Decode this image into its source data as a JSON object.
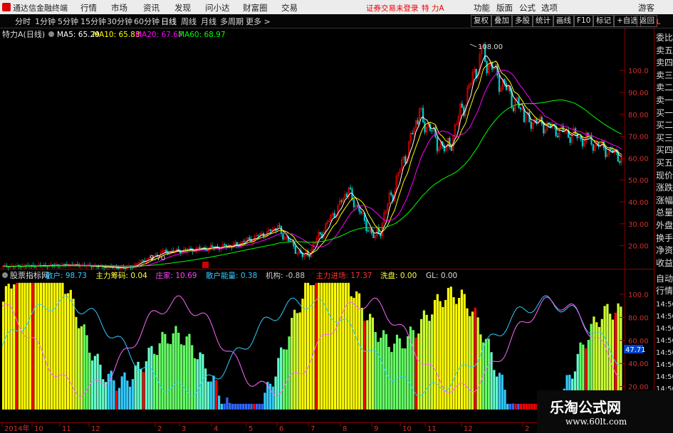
{
  "titlebar": {
    "app_name": "通达信金融终端",
    "menu": [
      "行情",
      "市场",
      "资讯",
      "发现",
      "问小达",
      "财富圈",
      "交易"
    ],
    "login_warning": "证券交易未登录",
    "stock": "特 力A",
    "right_menu": [
      "功能",
      "版面",
      "公式",
      "选项"
    ],
    "guest": "游客"
  },
  "toolbar": {
    "periods": [
      "分时",
      "1分钟",
      "5分钟",
      "15分钟",
      "30分钟",
      "60分钟",
      "日线",
      "周线",
      "月线",
      "多周期",
      "更多 >"
    ],
    "selected": "日线",
    "buttons": [
      "复权",
      "叠加",
      "多股",
      "统计",
      "画线",
      "F10",
      "标记",
      "+自选",
      "返回"
    ]
  },
  "price_chart": {
    "stock_title": "特力A(日线)",
    "ma5": "MA5: 65.29",
    "ma10": "MA10: 65.83",
    "ma20": "MA20: 67.67",
    "ma60": "MA60: 68.97",
    "high_label": "108.00",
    "low_label": "9.70",
    "y_ticks": [
      "100.0",
      "90.00",
      "80.00",
      "70.00",
      "60.00",
      "50.00",
      "40.00",
      "30.00",
      "20.00"
    ]
  },
  "indicator": {
    "name": "股票指标网",
    "items": [
      {
        "label": "散户:",
        "value": "98.73",
        "color": "#3cf"
      },
      {
        "label": "主力筹码:",
        "value": "0.04",
        "color": "#ff4"
      },
      {
        "label": "庄家:",
        "value": "10.69",
        "color": "#f4f"
      },
      {
        "label": "散户能量:",
        "value": "0.38",
        "color": "#3cf"
      },
      {
        "label": "机构:",
        "value": "-0.88",
        "color": "#ccc"
      },
      {
        "label": "主力进场:",
        "value": "17.37",
        "color": "#f33"
      },
      {
        "label": "洗盘:",
        "value": "0.00",
        "color": "#ff4"
      },
      {
        "label": "GL:",
        "value": "0.00",
        "color": "#ddd"
      }
    ],
    "y_ticks": [
      "100.0",
      "80.00",
      "60.00",
      "40.00",
      "20.00"
    ],
    "current": "47.71"
  },
  "x_axis": {
    "labels": [
      "2014年",
      "10",
      "11",
      "12",
      "2",
      "3",
      "4",
      "5",
      "6",
      "7",
      "8",
      "9",
      "10",
      "11",
      "12",
      "2"
    ]
  },
  "right_panel": {
    "items": [
      "委比",
      "卖五",
      "卖四",
      "卖三",
      "卖二",
      "卖一",
      "买一",
      "买二",
      "买三",
      "买四",
      "买五",
      "现价",
      "涨跌",
      "涨幅",
      "总量",
      "外盘",
      "换手",
      "净资",
      "收益"
    ],
    "lower_items": [
      "自动",
      "行情"
    ],
    "times": [
      "14:50",
      "14:50",
      "14:50",
      "14:50",
      "14:50",
      "14:50",
      "14:50",
      "14:50",
      "14:50",
      "14:50",
      "14:50"
    ]
  },
  "watermark": {
    "title": "乐淘公式网",
    "url": "www.60lt.com"
  },
  "colors": {
    "up": "#e00000",
    "down": "#00c8c8",
    "ma5": "#ffffff",
    "ma10": "#ffff00",
    "ma20": "#ff00ff",
    "ma60": "#00ff00"
  }
}
